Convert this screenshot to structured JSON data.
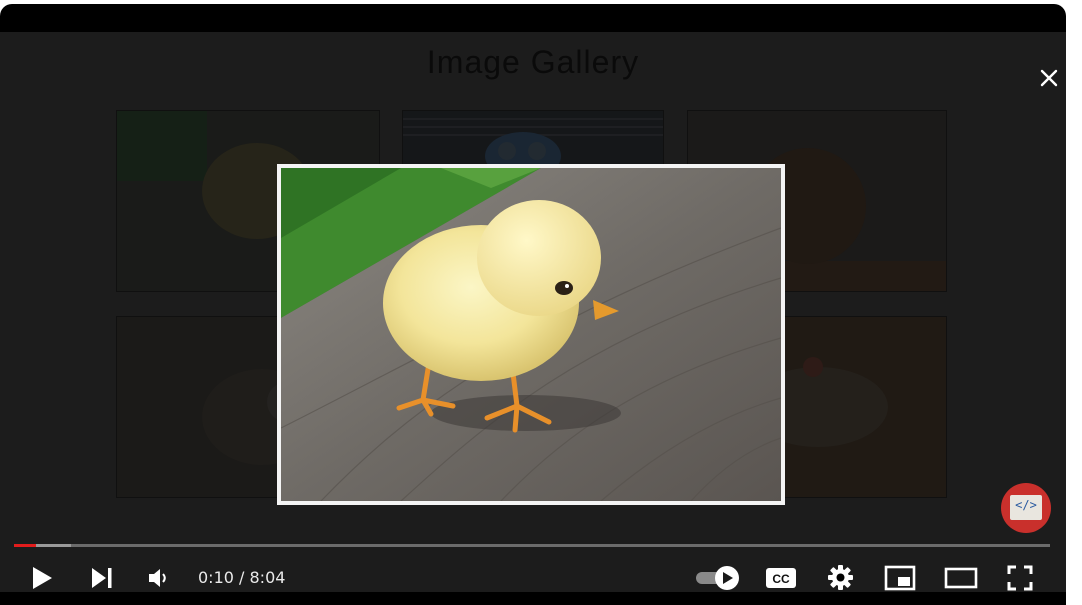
{
  "gallery": {
    "title": "Image Gallery"
  },
  "modal": {
    "image_subject": "yellow chick on wooden plank"
  },
  "badge": {
    "label": "</>"
  },
  "player": {
    "progress_fraction": 0.021,
    "buffered_fraction": 0.055,
    "current_time": "0:10",
    "duration": "8:04",
    "time_display": "0:10 / 8:04",
    "autoplay_on": true,
    "icons": {
      "play": "play-icon",
      "next": "next-icon",
      "volume": "volume-icon",
      "autoplay": "autoplay-toggle-icon",
      "captions": "cc-icon",
      "settings": "gear-icon",
      "miniplayer": "miniplayer-icon",
      "theater": "theater-icon",
      "fullscreen": "fullscreen-icon",
      "close": "close-icon"
    },
    "colors": {
      "progress": "#e21c1c",
      "badge": "#c9302c"
    }
  }
}
